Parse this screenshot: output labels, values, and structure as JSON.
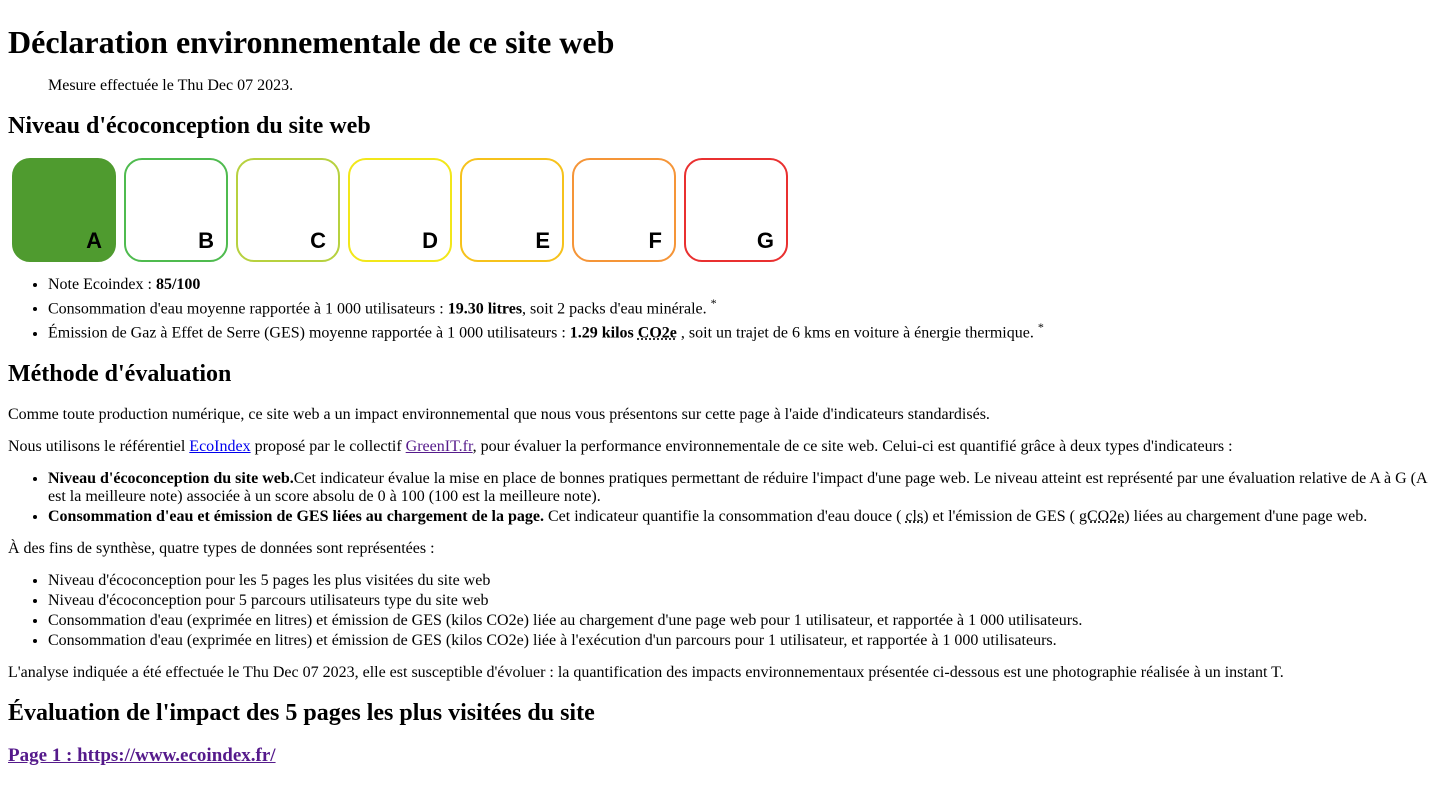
{
  "title": "Déclaration environnementale de ce site web",
  "measured_on_prefix": "Mesure effectuée le ",
  "measured_on_date": "Thu Dec 07 2023",
  "measured_on_suffix": ".",
  "section_niveau": "Niveau d'écoconception du site web",
  "grades": {
    "A": "A",
    "B": "B",
    "C": "C",
    "D": "D",
    "E": "E",
    "F": "F",
    "G": "G",
    "active": "A",
    "colors": {
      "A": "#4f9b2f",
      "B": "#4fbb4f",
      "C": "#b7d13f",
      "D": "#f2e71a",
      "E": "#f6c21c",
      "F": "#f59538",
      "G": "#e93030"
    }
  },
  "stats": {
    "ecoindex_label": "Note Ecoindex : ",
    "ecoindex_value": "85/100",
    "water_label": "Consommation d'eau moyenne rapportée à 1 000 utilisateurs : ",
    "water_value": "19.30 litres",
    "water_suffix": ", soit 2 packs d'eau minérale. ",
    "ges_label": "Émission de Gaz à Effet de Serre (GES) moyenne rapportée à 1 000 utilisateurs : ",
    "ges_value": "1.29 kilos ",
    "ges_abbr": "CO2e",
    "ges_abbr_title": "équivalent CO2",
    "ges_suffix": " , soit un trajet de 6 kms en voiture à énergie thermique. ",
    "asterisk": "*"
  },
  "section_methode": "Méthode d'évaluation",
  "para1": "Comme toute production numérique, ce site web a un impact environnemental que nous vous présentons sur cette page à l'aide d'indicateurs standardisés.",
  "para2": {
    "pre": "Nous utilisons le référentiel ",
    "link1_text": "EcoIndex",
    "link1_href": "#",
    "mid": " proposé par le collectif ",
    "link2_text": "GreenIT.fr",
    "link2_href": "#",
    "post": ", pour évaluer la performance environnementale de ce site web. Celui-ci est quantifié grâce à deux types d'indicateurs :"
  },
  "indicators": {
    "item1_strong": "Niveau d'écoconception du site web.",
    "item1_text": "Cet indicateur évalue la mise en place de bonnes pratiques permettant de réduire l'impact d'une page web. Le niveau atteint est représenté par une évaluation relative de A à G (A est la meilleure note) associée à un score absolu de 0 à 100 (100 est la meilleure note).",
    "item2_strong": "Consommation d'eau et émission de GES liées au chargement de la page.",
    "item2_pre": " Cet indicateur quantifie la consommation d'eau douce ( ",
    "item2_abbr1": "cls",
    "item2_abbr1_title": "centilitres",
    "item2_mid": ") et l'émission de GES ( ",
    "item2_abbr2": "gCO2e",
    "item2_abbr2_title": "grammes équivalent CO2",
    "item2_post": ") liées au chargement d'une page web."
  },
  "para3": "À des fins de synthèse, quatre types de données sont représentées :",
  "data_types": [
    "Niveau d'écoconception pour les 5 pages les plus visitées du site web",
    "Niveau d'écoconception pour 5 parcours utilisateurs type du site web",
    "Consommation d'eau (exprimée en litres) et émission de GES (kilos CO2e) liée au chargement d'une page web pour 1 utilisateur, et rapportée à 1 000 utilisateurs.",
    "Consommation d'eau (exprimée en litres) et émission de GES (kilos CO2e) liée à l'exécution d'un parcours pour 1 utilisateur, et rapportée à 1 000 utilisateurs."
  ],
  "para4": "L'analyse indiquée a été effectuée le Thu Dec 07 2023, elle est susceptible d'évoluer : la quantification des impacts environnementaux présentée ci-dessous est une photographie réalisée à un instant T.",
  "section_eval": "Évaluation de l'impact des 5 pages les plus visitées du site",
  "page1_link_text": "Page 1 : https://www.ecoindex.fr/",
  "page1_link_href": "#"
}
